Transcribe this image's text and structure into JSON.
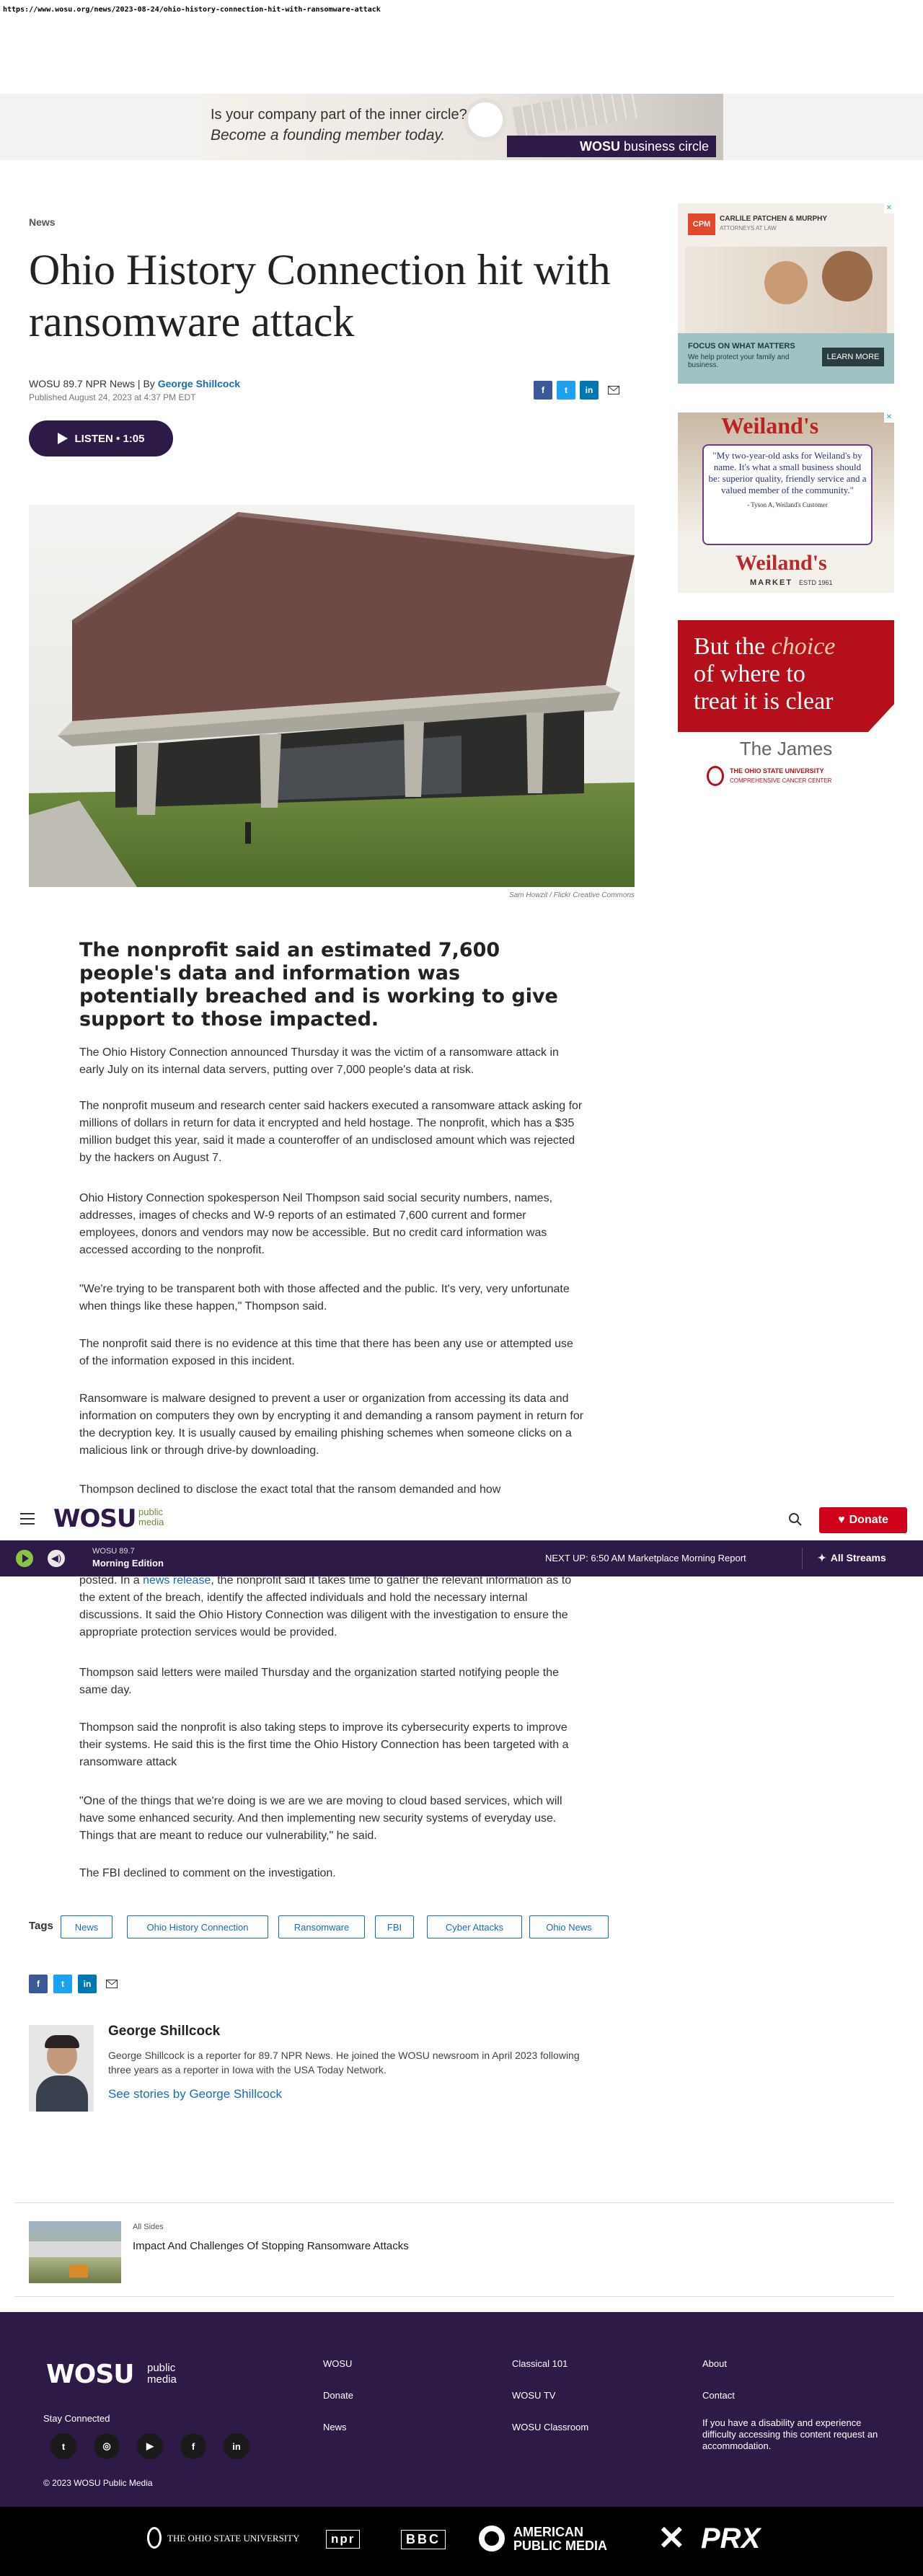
{
  "url": "https://www.wosu.org/news/2023-08-24/ohio-history-connection-hit-with-ransomware-attack",
  "top_ad": {
    "line1": "Is your company part of the inner circle?",
    "line2": "Become a founding member today.",
    "brand_strong": "WOSU",
    "brand_rest": " business circle"
  },
  "article": {
    "kicker": "News",
    "headline": "Ohio History Connection hit with ransomware attack",
    "byline_outlet": "WOSU 89.7 NPR News | By ",
    "byline_author": "George Shillcock",
    "published": "Published August 24, 2023 at 4:37 PM EDT",
    "listen_label": "LISTEN",
    "listen_sep": " • ",
    "listen_duration": "1:05",
    "photo_credit": "Sam Howzit / Flickr Creative Commons",
    "summary": "The nonprofit said an estimated 7,600 people's data and information was potentially breached and is working to give support to those impacted.",
    "paragraphs": [
      "The Ohio History Connection announced Thursday it was the victim of a ransomware attack in early July on its internal data servers, putting over 7,000 people's data at risk.",
      "The nonprofit museum and research center said hackers executed a ransomware attack asking for millions of dollars in return for data it encrypted and held hostage. The nonprofit, which has a $35 million budget this year, said it made a counteroffer of an undisclosed amount which was rejected by the hackers on August 7.",
      "Ohio History Connection spokesperson Neil Thompson said social security numbers, names, addresses, images of checks and W-9 reports of an estimated 7,600 current and former employees, donors and vendors may now be accessible. But no credit card information was accessed according to the nonprofit.",
      "\"We're trying to be transparent both with those affected and the public. It's very, very unfortunate when things like these happen,\" Thompson said.",
      "The nonprofit said there is no evidence at this time that there has been any use or attempted use of the information exposed in this incident.",
      "Ransomware is malware designed to prevent a user or organization from accessing its data and information on computers they own by encrypting it and demanding a ransom payment in return for the decryption key. It is usually caused by emailing phishing schemes when someone clicks on a malicious link or through drive-by downloading.",
      "Thompson declined to disclose the exact total that the ransom demanded and how"
    ],
    "para_after_pre": "posted. In a ",
    "para_after_link": "news release",
    "para_after_post": ", the nonprofit said it takes time to gather the relevant information as to the extent of the breach, identify the affected individuals and hold the necessary internal discussions. It said the Ohio History Connection was diligent with the investigation to ensure the appropriate protection services would be provided.",
    "paragraphs_end": [
      "Thompson said letters were mailed Thursday and the organization started notifying people the same day.",
      "Thompson said the nonprofit is also taking steps to improve its cybersecurity experts to improve their systems. He said this is the first time the Ohio History Connection has been targeted with a ransomware attack",
      "\"One of the things that we're doing is we are we are moving to cloud based services, which will have some enhanced security. And then implementing new security systems of everyday use. Things that are meant to reduce our vulnerability,\" he said.",
      "The FBI declined to comment on the investigation."
    ]
  },
  "tags_label": "Tags",
  "tags": [
    "News",
    "Ohio History Connection",
    "Ransomware",
    "FBI",
    "Cyber Attacks",
    "Ohio News"
  ],
  "author_box": {
    "name": "George Shillcock",
    "bio": "George Shillcock is a reporter for 89.7 NPR News. He joined the WOSU newsroom in April 2023 following three years as a reporter in Iowa with the USA Today Network.",
    "link": "See stories by George Shillcock"
  },
  "related": {
    "kicker": "All Sides",
    "title": "Impact And Challenges Of Stopping Ransomware Attacks"
  },
  "ads": {
    "carlile": {
      "brand": "CARLILE PATCHEN & MURPHY",
      "sub": "ATTORNEYS AT LAW",
      "tag1": "FOCUS ON WHAT MATTERS",
      "tag2": "We help protect your family and business.",
      "cta": "LEARN MORE"
    },
    "weilands": {
      "sign": "Weiland's",
      "quote": "\"My two-year-old asks for Weiland's by name. It's what a small business should be: superior quality, friendly service and a valued member of the community.\"",
      "attrib": "- Tyson A, Weiland's Customer",
      "brand": "Weiland's",
      "sub": "MARKET",
      "est": "ESTD 1961"
    },
    "james": {
      "l1": "But the ",
      "l1b": "choice",
      "l2": "of where to",
      "l3": "treat it is clear",
      "brand": "The James",
      "sub1": "THE OHIO STATE UNIVERSITY",
      "sub2": "COMPREHENSIVE CANCER CENTER"
    }
  },
  "nav": {
    "logo": "WOSU",
    "logo_sub1": "public",
    "logo_sub2": "media",
    "donate": "Donate"
  },
  "player": {
    "station": "WOSU 89.7",
    "show": "Morning Edition",
    "next_up": "NEXT UP: 6:50 AM Marketplace Morning Report",
    "all_streams": "All Streams"
  },
  "footer": {
    "logo": "WOSU",
    "logo_sub1": "public",
    "logo_sub2": "media",
    "stay": "Stay Connected",
    "col1": [
      "WOSU",
      "Donate",
      "News"
    ],
    "col2": [
      "Classical 101",
      "WOSU TV",
      "WOSU Classroom"
    ],
    "col3": [
      "About",
      "Contact"
    ],
    "access": "If you have a disability and experience difficulty accessing this content request an accommodation.",
    "copyright": "© 2023 WOSU Public Media"
  },
  "partners": {
    "osu": "THE OHIO STATE UNIVERSITY",
    "npr": "npr",
    "bbc": "BBC",
    "apm1": "AMERICAN",
    "apm2": "PUBLIC MEDIA",
    "prx": "PRX"
  },
  "colors": {
    "brand": "#2e1a47",
    "link": "#1a6bb5",
    "donate": "#d0021b"
  }
}
